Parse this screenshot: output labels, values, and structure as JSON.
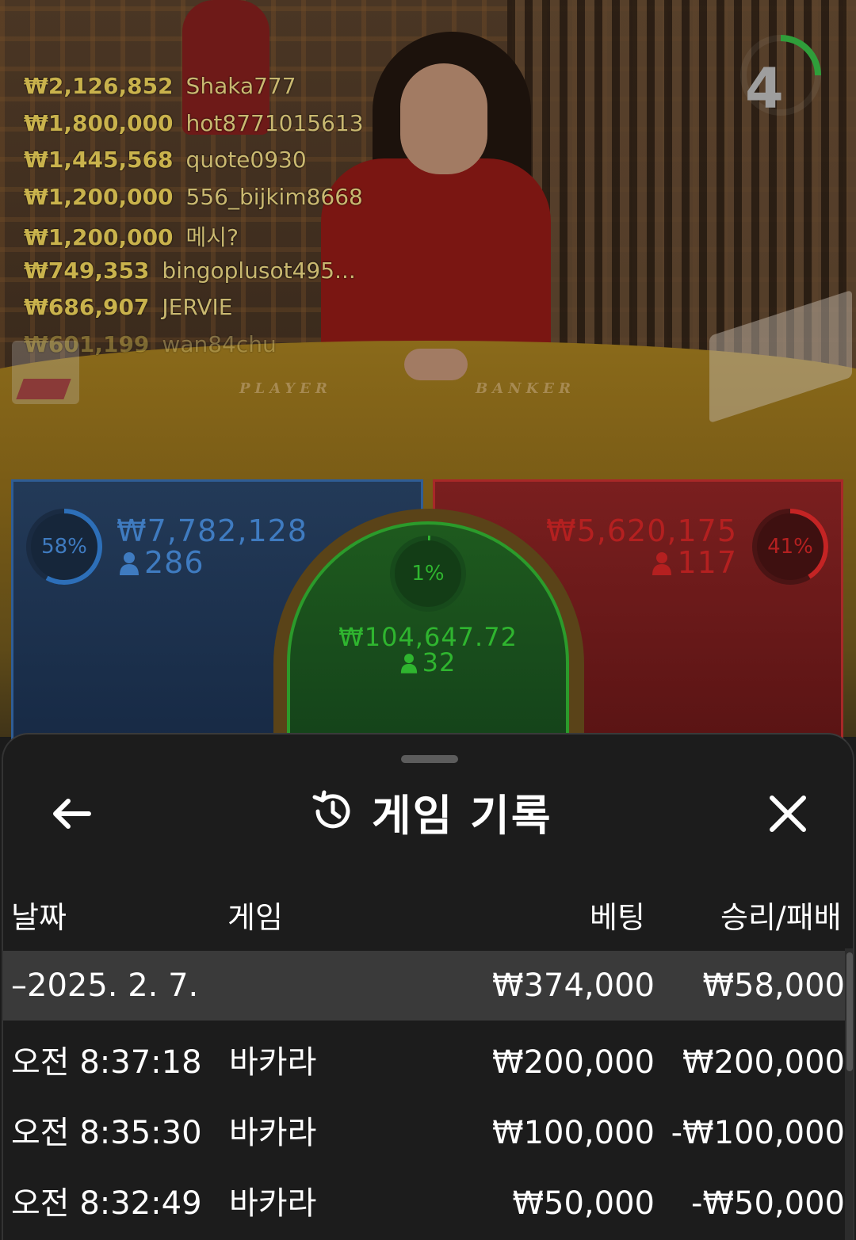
{
  "leaderboard": [
    {
      "amount": "₩2,126,852",
      "name": "Shaka777"
    },
    {
      "amount": "₩1,800,000",
      "name": "hot8771015613"
    },
    {
      "amount": "₩1,445,568",
      "name": "quote0930"
    },
    {
      "amount": "₩1,200,000",
      "name": "556_bijkim8668"
    },
    {
      "amount": "₩1,200,000",
      "name": "메시?"
    },
    {
      "amount": "₩749,353",
      "name": "bingoplusot495..."
    },
    {
      "amount": "₩686,907",
      "name": "JERVIE"
    },
    {
      "amount": "₩601,199",
      "name": "wan84chu"
    }
  ],
  "timer": {
    "seconds": "4",
    "fraction_remaining": 0.25,
    "color": "#2f9e3a"
  },
  "table_labels": {
    "player": "PLAYER",
    "banker": "BANKER"
  },
  "bets": {
    "player": {
      "percent_label": "58%",
      "percent": 58,
      "amount": "₩7,782,128",
      "players": "286",
      "color": "#3f7bc0"
    },
    "tie": {
      "percent_label": "1%",
      "percent": 1,
      "amount": "₩104,647.72",
      "players": "32",
      "color": "#2fb52f"
    },
    "banker": {
      "percent_label": "41%",
      "percent": 41,
      "amount": "₩5,620,175",
      "players": "117",
      "color": "#b42020"
    }
  },
  "history": {
    "title": "게임 기록",
    "icons": {
      "back": "arrow-left-icon",
      "history": "history-icon",
      "close": "close-icon"
    },
    "columns": {
      "date": "날짜",
      "game": "게임",
      "bet": "베팅",
      "result": "승리/패배"
    },
    "date_row": {
      "date": "–2025. 2. 7.",
      "bet": "₩374,000",
      "result": "₩58,000"
    },
    "rows": [
      {
        "time": "오전 8:37:18",
        "game": "바카라",
        "bet": "₩200,000",
        "result": "₩200,000"
      },
      {
        "time": "오전 8:35:30",
        "game": "바카라",
        "bet": "₩100,000",
        "result": "-₩100,000"
      },
      {
        "time": "오전 8:32:49",
        "game": "바카라",
        "bet": "₩50,000",
        "result": "-₩50,000"
      }
    ]
  }
}
